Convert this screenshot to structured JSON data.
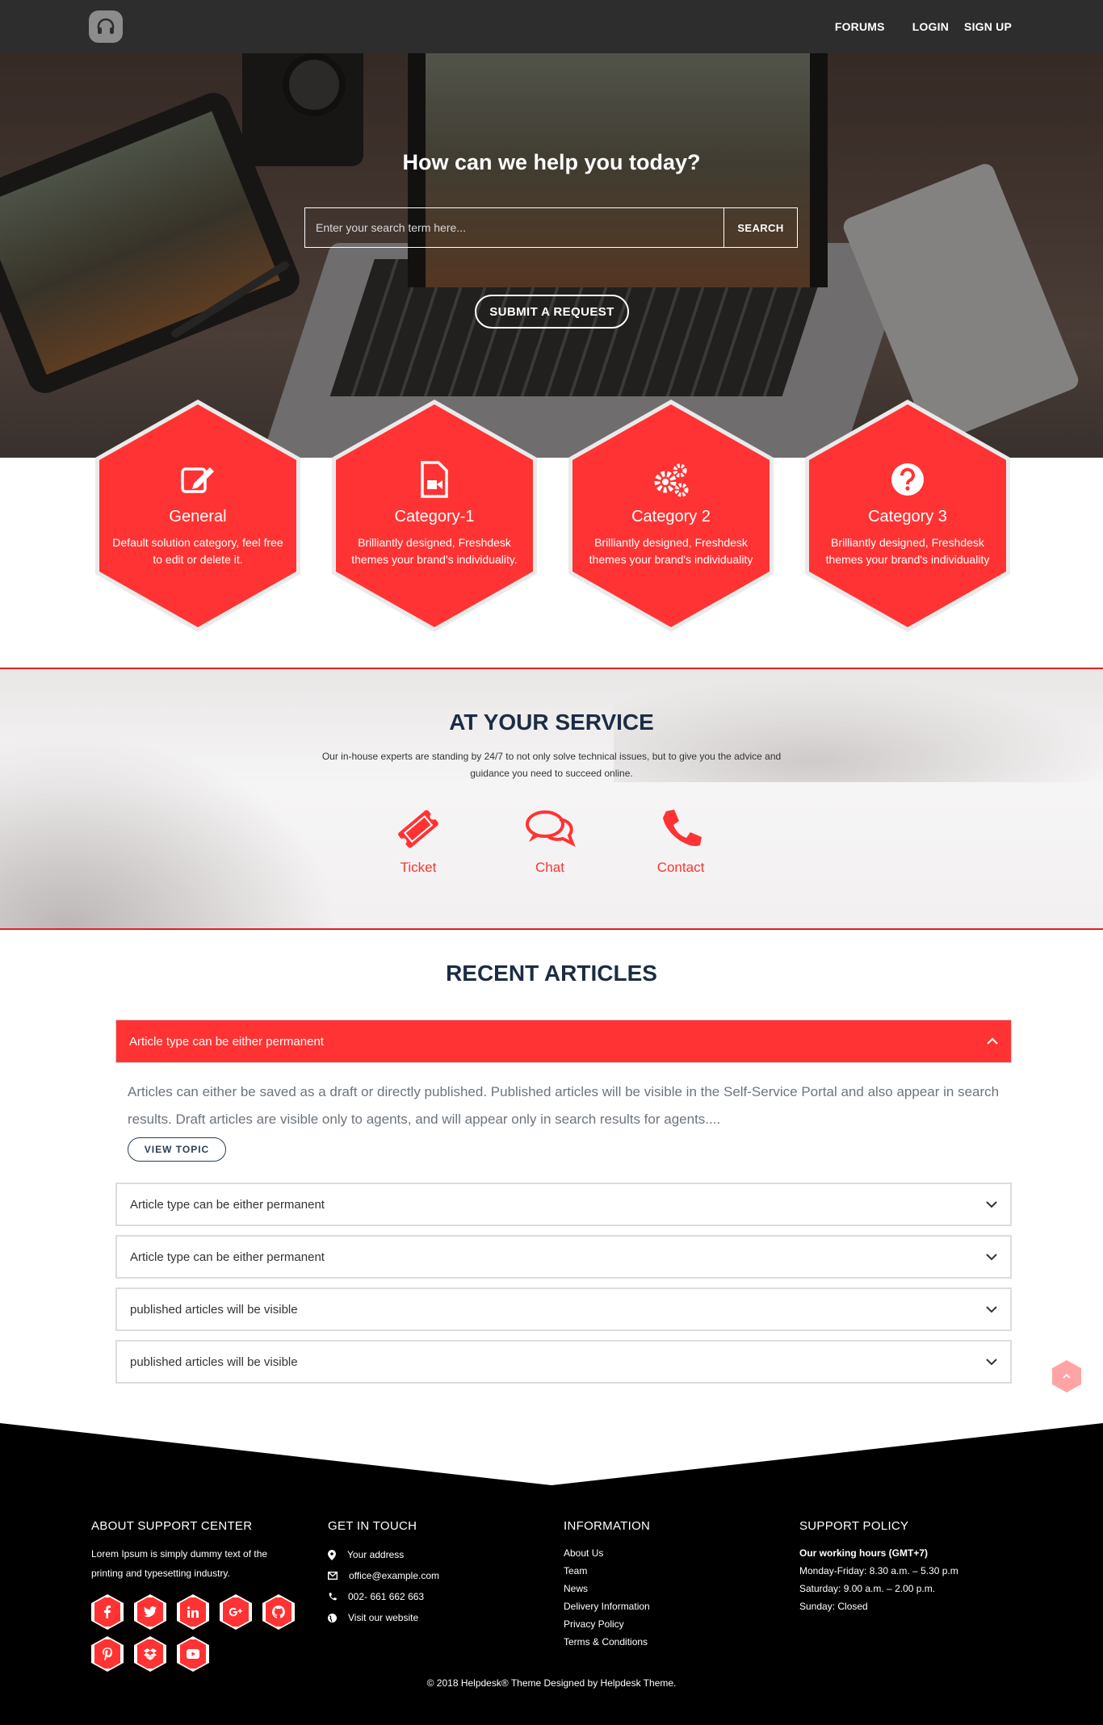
{
  "header": {
    "nav": {
      "forums": "FORUMS",
      "login": "LOGIN",
      "signup": "SIGN UP"
    }
  },
  "hero": {
    "title": "How can we help you today?",
    "search_placeholder": "Enter your search term here...",
    "search_button": "SEARCH",
    "submit_button": "SUBMIT A REQUEST"
  },
  "categories": [
    {
      "icon": "edit-icon",
      "title": "General",
      "desc": "Default solution category, feel free to edit or delete it."
    },
    {
      "icon": "video-file-icon",
      "title": "Category-1",
      "desc": "Brilliantly designed, Freshdesk themes your brand's individuality."
    },
    {
      "icon": "gears-icon",
      "title": "Category 2",
      "desc": "Brilliantly designed, Freshdesk themes your brand's individuality"
    },
    {
      "icon": "question-circle-icon",
      "title": "Category 3",
      "desc": "Brilliantly designed, Freshdesk themes your brand's individuality"
    }
  ],
  "service": {
    "title": "AT YOUR SERVICE",
    "text": "Our in-house experts are standing by 24/7 to not only solve technical issues, but to give you the advice and guidance you need to succeed online.",
    "items": [
      {
        "icon": "ticket-icon",
        "label": "Ticket"
      },
      {
        "icon": "chat-icon",
        "label": "Chat"
      },
      {
        "icon": "phone-icon",
        "label": "Contact"
      }
    ]
  },
  "articles": {
    "title": "RECENT ARTICLES",
    "active": {
      "title": "Article type can be either permanent",
      "body": "Articles can either be saved as a draft or directly published. Published articles will be visible in the Self-Service Portal and also appear in search results. Draft articles are visible only to agents, and will appear only in search results for agents....",
      "button": "VIEW TOPIC"
    },
    "items": [
      "Article type can be either permanent",
      "Article type can be either permanent",
      "published articles will be visible",
      "published articles will be visible"
    ]
  },
  "footer": {
    "about": {
      "title": "ABOUT SUPPORT CENTER",
      "text": "Lorem Ipsum is simply dummy text of the printing and typesetting industry."
    },
    "socials": [
      "facebook-icon",
      "twitter-icon",
      "linkedin-icon",
      "google-plus-icon",
      "github-icon",
      "pinterest-icon",
      "dropbox-icon",
      "youtube-icon"
    ],
    "touch": {
      "title": "GET IN TOUCH",
      "address": "Your address",
      "email": "office@example.com",
      "phone": "002- 661 662 663",
      "website": "Visit our website"
    },
    "info": {
      "title": "INFORMATION",
      "links": [
        "About Us",
        "Team",
        "News",
        "Delivery Information",
        "Privacy Policy",
        "Terms & Conditions"
      ]
    },
    "policy": {
      "title": "SUPPORT POLICY",
      "hours_title": "Our working hours (GMT+7)",
      "lines": [
        "Monday-Friday: 8.30 a.m. – 5.30 p.m",
        "Saturday: 9.00 a.m. – 2.00 p.m.",
        "Sunday: Closed"
      ]
    },
    "copyright": "© 2018 Helpdesk® Theme Designed by Helpdesk Theme."
  },
  "colors": {
    "accent": "#ff3333",
    "header": "#2d2d2d",
    "footer": "#000000",
    "heading": "#1d2c45"
  }
}
